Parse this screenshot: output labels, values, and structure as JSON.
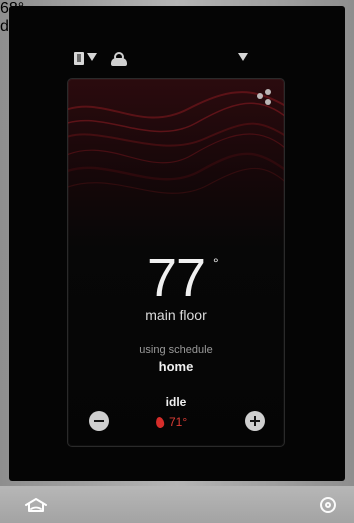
{
  "header": {
    "outdoor_temp": "68°",
    "user": "dad"
  },
  "card": {
    "current_temp": "77",
    "degree_symbol": "°",
    "zone_name": "main floor",
    "schedule_label": "using schedule",
    "schedule_name": "home",
    "status": "idle",
    "setpoint": "71°"
  },
  "icons": {
    "notebook": "notebook-icon",
    "weather": "partly-cloudy-icon",
    "menu": "menu-dots-icon",
    "minus": "minus-icon",
    "plus": "plus-icon",
    "flame": "flame-icon",
    "home": "home-icon",
    "settings": "ring-icon"
  },
  "colors": {
    "accent_red": "#dc3c35",
    "screen_background": "#050505",
    "bezel": "#b5b5b5"
  }
}
